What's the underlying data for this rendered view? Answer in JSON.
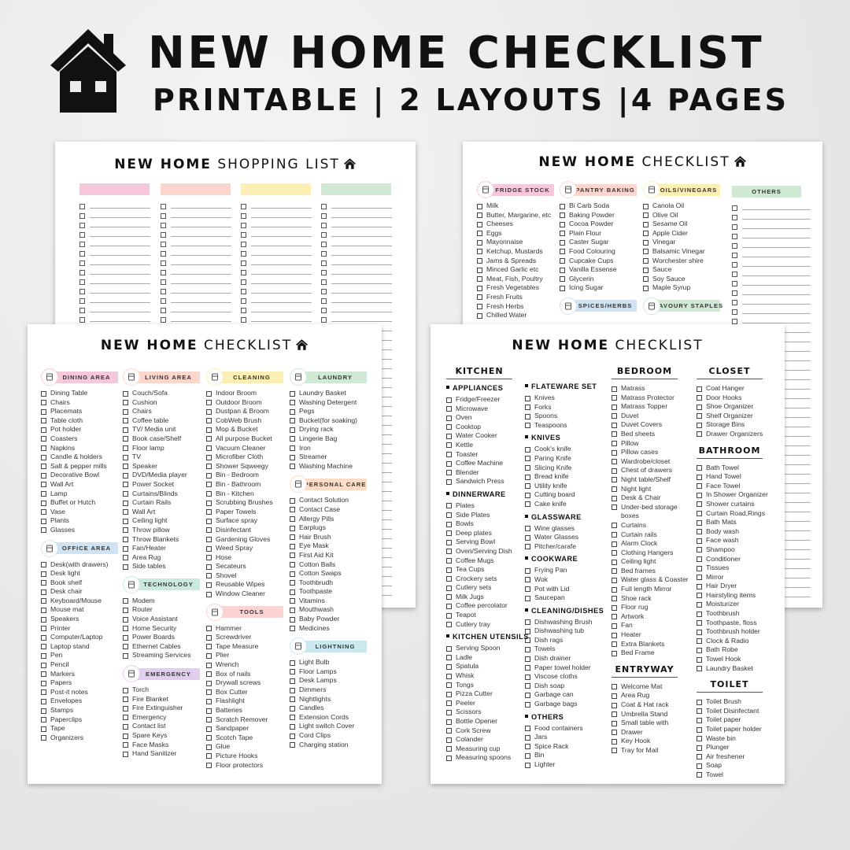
{
  "hero": {
    "title": "NEW HOME CHECKLIST",
    "subtitle": "PRINTABLE | 2 LAYOUTS |4 PAGES",
    "icon": "house-icon"
  },
  "shopping_list": {
    "title_bold": "NEW HOME",
    "title_rest": "SHOPPING LIST",
    "bar_colors": [
      "#f7c7dc",
      "#fcd6cc",
      "#fbefb3",
      "#cfe9d4"
    ]
  },
  "pantry_checklist": {
    "title_bold": "NEW HOME",
    "title_rest": "CHECKLIST",
    "columns": [
      [
        {
          "type": "pill",
          "label": "FRIDGE STOCK",
          "color": "#f7c7dc",
          "icon": "fridge-icon",
          "items": [
            "Milk",
            "Butter, Margarine, etc",
            "Cheeses",
            "Eggs",
            "Mayonnaise",
            "Ketchup, Mustards",
            "Jams & Spreads",
            "Minced Garlic etc",
            "Meat, Fish, Poultry",
            "Fresh Vegetables",
            "Fresh Fruits",
            "Fresh Herbs",
            "Chilled Water"
          ]
        }
      ],
      [
        {
          "type": "pill",
          "label": "PANTRY BAKING",
          "color": "#fcd6cc",
          "icon": "cake-icon",
          "items": [
            "Bi Carb Soda",
            "Baking Powder",
            "Cocoa Powder",
            "Plain Flour",
            "Caster Sugar",
            "Food Colouring",
            "Cupcake Cups",
            "Vanilla Essense",
            "Glycerin",
            "Icing Sugar"
          ]
        },
        {
          "type": "pill",
          "label": "SPICES/HERBS",
          "color": "#cfe3f5",
          "icon": "herbs-icon",
          "items": []
        }
      ],
      [
        {
          "type": "pill",
          "label": "OILS/VINEGARS",
          "color": "#fbefb3",
          "icon": "oil-bottle-icon",
          "items": [
            "Canola Oil",
            "Olive Oil",
            "Sesame Oil",
            "Apple Cider",
            "Vinegar",
            "Balsamic Vinegar",
            "Worchester shire",
            "Sauce",
            "Soy Sauce",
            "Maple Syrup"
          ]
        },
        {
          "type": "pill",
          "label": "SAVOURY STAPLES",
          "color": "#cfe9d4",
          "icon": "bowl-icon",
          "items": []
        }
      ],
      [
        {
          "type": "bar",
          "label": "OTHERS",
          "color": "#cfe9d4",
          "items": []
        }
      ]
    ]
  },
  "room_checklist": {
    "title_bold": "NEW HOME",
    "title_rest": "CHECKLIST",
    "columns": [
      [
        {
          "type": "pill",
          "label": "DINING AREA",
          "color": "#f7c7dc",
          "icon": "dining-icon",
          "items": [
            "Dining Table",
            "Chairs",
            "Placemats",
            "Table cloth",
            "Pot holder",
            "Coasters",
            "Napkins",
            "Candle & holders",
            "Salt & pepper mills",
            "Decorative Bowl",
            "Wall Art",
            "Lamp",
            "Buffet or Hutch",
            "Vase",
            "Plants",
            "Glasses"
          ]
        },
        {
          "type": "pill",
          "label": "OFFICE AREA",
          "color": "#cfe3f5",
          "icon": "desk-icon",
          "items": [
            "Desk(with drawers)",
            "Desk light",
            "Book shelf",
            "Desk chair",
            "Keyboard/Mouse",
            "Mouse mat",
            "Speakers",
            "Printer",
            "Computer/Laptop",
            "Laptop stand",
            "Pen",
            "Pencil",
            "Markers",
            "Papers",
            "Post-it notes",
            "Envelopes",
            "Stamps",
            "Paperclips",
            "Tape",
            "Organizers"
          ]
        }
      ],
      [
        {
          "type": "pill",
          "label": "LIVING AREA",
          "color": "#fcd6cc",
          "icon": "sofa-icon",
          "items": [
            "Couch/Sofa",
            "Cushion",
            "Chairs",
            "Coffee table",
            "TV/ Media unit",
            "Book case/Shelf",
            "Floor lamp",
            "TV",
            "Speaker",
            "DVD/Media player",
            "Power Socket",
            "Curtains/Blinds",
            "Curtain Rails",
            "Wall Art",
            "Ceiling light",
            "Throw pillow",
            "Throw Blankets",
            "Fan/Heater",
            "Area Rug",
            "Side tables"
          ]
        },
        {
          "type": "pill",
          "label": "TECHNOLOGY",
          "color": "#c8eadf",
          "icon": "router-icon",
          "items": [
            "Modem",
            "Router",
            "Voice Assistant",
            "Home Security",
            "Power Boards",
            "Ethernet Cables",
            "Streaming Services"
          ]
        },
        {
          "type": "pill",
          "label": "EMERGENCY",
          "color": "#e3cdee",
          "icon": "extinguisher-icon",
          "items": [
            "Torch",
            "Fire Blanket",
            "Fire Extinguisher",
            "Emergency",
            "Contact list",
            "Spare Keys",
            "Face Masks",
            "Hand Sanitizer"
          ]
        }
      ],
      [
        {
          "type": "pill",
          "label": "CLEANING",
          "color": "#fbefb3",
          "icon": "house-clean-icon",
          "items": [
            "Indoor Broom",
            "Outdoor Broom",
            "Dustpan & Broom",
            "CobWeb Brush",
            "Mop & Bucket",
            "All purpose Bucket",
            "Vacuum Cleaner",
            "Microfiber Cloth",
            "Shower Sqweegy",
            "Bin - Bedroom",
            "Bin - Bathroom",
            "Bin - Kitchen",
            "Scrubbing Brushes",
            "Paper Towels",
            "Surface spray",
            "Disinfectant",
            "Gardening Gloves",
            "Weed Spray",
            "Hose",
            "Secateurs",
            "Shovel",
            "Reusable Wipes",
            "Window Cleaner"
          ]
        },
        {
          "type": "pill",
          "label": "TOOLS",
          "color": "#fbd3d3",
          "icon": "tools-icon",
          "items": [
            "Hammer",
            "Screwdriver",
            "Tape Measure",
            "Plier",
            "Wrench",
            "Box of nails",
            "Drywall screws",
            "Box Cutter",
            "Flashlight",
            "Batteries",
            "Scratch Remover",
            "Sandpaper",
            "Scotch Tape",
            "Glue",
            "Picture Hooks",
            "Floor protectors"
          ]
        }
      ],
      [
        {
          "type": "pill",
          "label": "LAUNDRY",
          "color": "#cfe9d4",
          "icon": "washing-machine-icon",
          "items": [
            "Laundry Basket",
            "Washing Detergent",
            "Pegs",
            "Bucket(for soaking)",
            "Drying rack",
            "Lingerie Bag",
            "Iron",
            "Streamer",
            "Washing Machine"
          ]
        },
        {
          "type": "pill",
          "label": "PERSONAL CARE",
          "color": "#fcdcc6",
          "icon": "soap-icon",
          "items": [
            "Contact Solution",
            "Contact Case",
            "Allergy Pills",
            "Earplugs",
            "Hair Brush",
            "Eye Mask",
            "First Aid Kit",
            "Cotton Balls",
            "Cotton Swaps",
            "Toothbrudh",
            "Toothpaste",
            "Vitamins",
            "Mouthwash",
            "Baby Powder",
            "Medicines"
          ]
        },
        {
          "type": "pill",
          "label": "LIGHTNING",
          "color": "#c9e9ef",
          "icon": "light-bulb-icon",
          "items": [
            "Light Bulb",
            "Floor Lamps",
            "Desk Lamps",
            "Dimmers",
            "Nightlights",
            "Candles",
            "Extension Cords",
            "Light switch Cover",
            "Cord Clips",
            "Charging station"
          ]
        }
      ]
    ]
  },
  "home_checklist": {
    "title_bold": "NEW HOME",
    "title_rest": "CHECKLIST",
    "columns": [
      [
        {
          "type": "main",
          "label": "KITCHEN",
          "items": []
        },
        {
          "type": "sub",
          "label": "APPLIANCES",
          "items": [
            "Fridge/Freezer",
            "Microwave",
            "Oven",
            "Cooktop",
            "Water Cooker",
            "Kettle",
            "Toaster",
            "Coffee Machine",
            "Blender",
            "Sandwich Press"
          ]
        },
        {
          "type": "sub",
          "label": "DINNERWARE",
          "items": [
            "Plates",
            "Side Plates",
            "Bowls",
            "Deep plates",
            "Serving Bowl",
            "Oven/Serving Dish",
            "Coffee Mugs",
            "Tea Cups",
            "Crockery sets",
            "Cutlery sets",
            "Milk Jugs",
            "Coffee percolator",
            "Teapot",
            "Cutlery tray"
          ]
        },
        {
          "type": "sub",
          "label": "KITCHEN UTENSILS",
          "items": [
            "Serving Spoon",
            "Ladle",
            "Spatula",
            "Whisk",
            "Tongs",
            "Pizza Cutter",
            "Peeler",
            "Scissors",
            "Bottle Opener",
            "Cork Screw",
            "Colander",
            "Measuring cup",
            "Measuring spoons"
          ]
        }
      ],
      [
        {
          "type": "sub",
          "label": "FLATEWARE SET",
          "items": [
            "Knives",
            "Forks",
            "Spoons",
            "Teaspoons"
          ]
        },
        {
          "type": "sub",
          "label": "KNIVES",
          "items": [
            "Cook's knife",
            "Paring Knife",
            "Slicing Knife",
            "Bread knife",
            "Utility knife",
            "Cutting board",
            "Cake knife"
          ]
        },
        {
          "type": "sub",
          "label": "GLASSWARE",
          "items": [
            "Wine glasses",
            "Water Glasses",
            "Pitcher/carafe"
          ]
        },
        {
          "type": "sub",
          "label": "COOKWARE",
          "items": [
            "Frying Pan",
            "Wok",
            "Pot with Lid",
            "Saucepan"
          ]
        },
        {
          "type": "sub",
          "label": "CLEANING/DISHES",
          "items": [
            "Dishwashing Brush",
            "Dishwashing tub",
            "Dish rags",
            "Towels",
            "Dish drainer",
            "Paper towel holder",
            "Viscose cloths",
            "Dish soap",
            "Garbage can",
            "Garbage bags"
          ]
        },
        {
          "type": "sub",
          "label": "OTHERS",
          "items": [
            "Food containers",
            "Jars",
            "Spice Rack",
            "Bin",
            "Lighter"
          ]
        }
      ],
      [
        {
          "type": "main",
          "label": "BEDROOM",
          "items": [
            "Matrass",
            "Matrass Protector",
            "Matrass Topper",
            "Duvet",
            "Duvet Covers",
            "Bed sheets",
            "Pillow",
            "Pillow cases",
            "Wardrobe/closet",
            "Chest of drawers",
            "Night table/Shelf",
            "Night light",
            "Desk & Chair",
            "Under-bed storage boxes",
            "Curtains",
            "Curtain rails",
            "Alarm Clock",
            "Clothing Hangers",
            "Ceiling light",
            "Bed frames",
            "Water glass & Coaster",
            "Full length Mirror",
            "Shoe rack",
            "Floor rug",
            "Artwork",
            "Fan",
            "Heater",
            "Extra Blankets",
            "Bed Frame"
          ]
        },
        {
          "type": "main",
          "label": "ENTRYWAY",
          "items": [
            "Welcome Mat",
            "Area Rug",
            "Coat & Hat rack",
            "Umbrella Stand",
            "Small table with",
            "Drawer",
            "Key Hook",
            "Tray for Mail"
          ]
        }
      ],
      [
        {
          "type": "main",
          "label": "CLOSET",
          "items": [
            "Coat Hanger",
            "Door Hooks",
            "Shoe Organizer",
            "Shelf Organizer",
            "Storage Bins",
            "Drawer Organizers"
          ]
        },
        {
          "type": "main",
          "label": "BATHROOM",
          "items": [
            "Bath Towel",
            "Hand Towel",
            "Face Towel",
            "In Shower Organizer",
            "Shower curtains",
            "Curtain Road,Rings",
            "Bath Mats",
            "Body wash",
            "Face wash",
            "Shampoo",
            "Conditioner",
            "Tissues",
            "Mirror",
            "Hair Dryer",
            "Hairstyling items",
            "Moisturizer",
            "Toothbrush",
            "Toothpaste, floss",
            "Toothbrush holder",
            "Clock & Radio",
            "Bath Robe",
            "Towel Hook",
            "Laundry Basket"
          ]
        },
        {
          "type": "main",
          "label": "TOILET",
          "items": [
            "Toilet Brush",
            "Toilet  Disinfectant",
            "Toilet paper",
            "Toilet paper holder",
            "Waste bin",
            "Plunger",
            " Air freshener",
            "Soap",
            "Towel"
          ]
        }
      ]
    ]
  }
}
